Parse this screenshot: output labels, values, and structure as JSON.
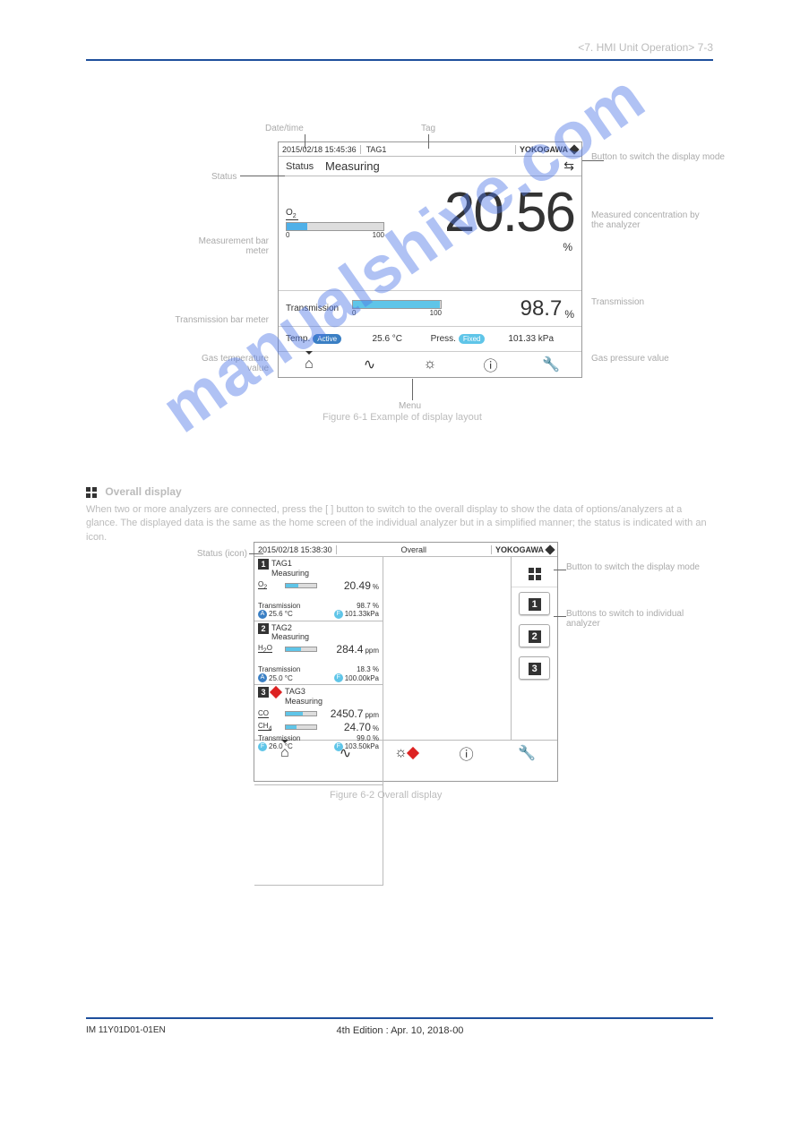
{
  "header_right": "<7. HMI Unit Operation>  7-3",
  "sections": {
    "fig61_caption": "Figure 6-1   Example of display layout",
    "fig62_caption": "Figure 6-2   Overall display",
    "overall_title": "Overall display",
    "overall_para": "When two or more analyzers are connected, press the [  ] button to switch to the overall display to show the data of options/analyzers at a glance. The displayed data is the same as the home screen of the individual analyzer but in a simplified manner; the status is indicated with an icon."
  },
  "callouts": {
    "a": [
      "Date/time",
      "Status",
      "Measurement bar meter",
      "Transmission bar meter",
      "Gas temperature value",
      "Tag",
      "Button to switch the display mode",
      "Measured concentration by the analyzer",
      "Transmission",
      "Gas pressure value",
      "Menu"
    ],
    "b": [
      "Status (icon)",
      "Button to switch the display mode",
      "Buttons to switch to individual analyzer"
    ]
  },
  "figA": {
    "datetime": "2015/02/18 15:45:36",
    "tag": "TAG1",
    "brand": "YOKOGAWA",
    "status_label": "Status",
    "status_value": "Measuring",
    "gas_label": "O₂",
    "scale_min": "0",
    "scale_max": "100",
    "gas_bar_pct": 21,
    "main_value": "20.56",
    "main_unit": "%",
    "trans_label": "Transmission",
    "trans_bar_pct": 99,
    "trans_value": "98.7",
    "trans_unit": "%",
    "temp_label": "Temp.",
    "temp_pill": "Active",
    "temp_value": "25.6",
    "temp_unit": "°C",
    "press_label": "Press.",
    "press_pill": "Fixed",
    "press_value": "101.33",
    "press_unit": "kPa"
  },
  "figB": {
    "datetime": "2015/02/18 15:38:30",
    "title": "Overall",
    "brand": "YOKOGAWA",
    "tiles": [
      {
        "num": "1",
        "tag": "TAG1",
        "status": "Measuring",
        "alarm": false,
        "gases": [
          {
            "label": "O₂",
            "bar": 40,
            "value": "20.49",
            "unit": "%"
          }
        ],
        "trans": "98.7 %",
        "temp_mode": "A",
        "temp": "25.6 °C",
        "press_mode": "F",
        "press": "101.33kPa"
      },
      {
        "num": "2",
        "tag": "TAG2",
        "status": "Measuring",
        "alarm": false,
        "gases": [
          {
            "label": "H₂O",
            "bar": 50,
            "value": "284.4",
            "unit": "ppm"
          }
        ],
        "trans": "18.3 %",
        "temp_mode": "A",
        "temp": "25.0 °C",
        "press_mode": "F",
        "press": "100.00kPa"
      },
      {
        "num": "3",
        "tag": "TAG3",
        "status": "Measuring",
        "alarm": true,
        "gases": [
          {
            "label": "CO",
            "bar": 55,
            "value": "2450.7",
            "unit": "ppm"
          },
          {
            "label": "CH₄",
            "bar": 35,
            "value": "24.70",
            "unit": "%"
          }
        ],
        "trans": "99.0 %",
        "temp_mode": "F",
        "temp": "26.0 °C",
        "press_mode": "F",
        "press": "103.50kPa"
      }
    ],
    "navs": [
      "1",
      "2",
      "3"
    ]
  },
  "footer_left": "IM 11Y01D01-01EN",
  "footer_center": "4th Edition : Apr. 10, 2018-00"
}
